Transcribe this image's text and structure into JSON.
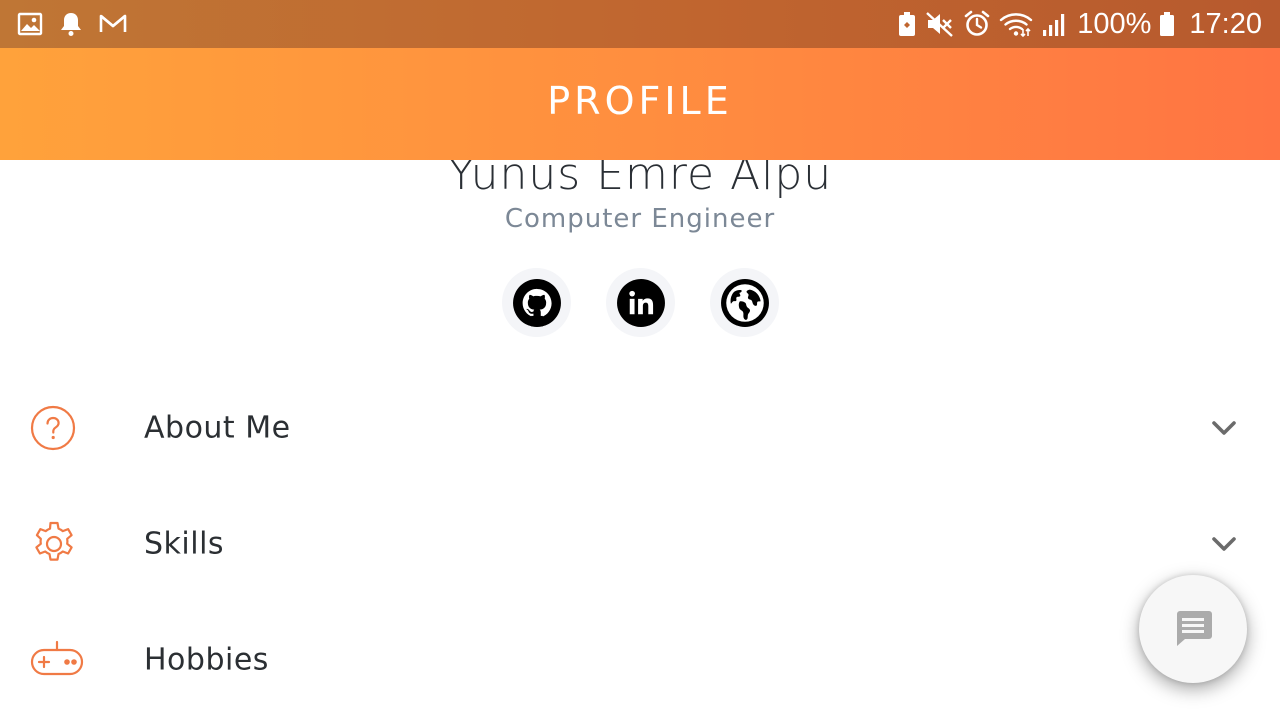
{
  "status_bar": {
    "battery_percent": "100%",
    "time": "17:20",
    "left_icons": [
      "gallery-icon",
      "notification-bell-icon",
      "gmail-icon"
    ],
    "right_icons": [
      "battery-saver-icon",
      "mute-icon",
      "alarm-icon",
      "wifi-icon",
      "signal-icon",
      "battery-icon"
    ]
  },
  "header": {
    "title": "PROFILE"
  },
  "profile": {
    "name": "Yunus Emre Alpu",
    "title": "Computer Engineer",
    "socials": [
      "github-icon",
      "linkedin-icon",
      "globe-icon"
    ]
  },
  "sections": [
    {
      "label": "About Me",
      "icon": "question-circle-icon"
    },
    {
      "label": "Skills",
      "icon": "gear-icon"
    },
    {
      "label": "Hobbies",
      "icon": "gamepad-icon"
    }
  ],
  "fab": {
    "icon": "chat-icon"
  },
  "colors": {
    "accent": "#f07a45",
    "header_gradient_start": "#ffa23b",
    "header_gradient_end": "#ff7443",
    "chevron": "#6b6b6b"
  }
}
